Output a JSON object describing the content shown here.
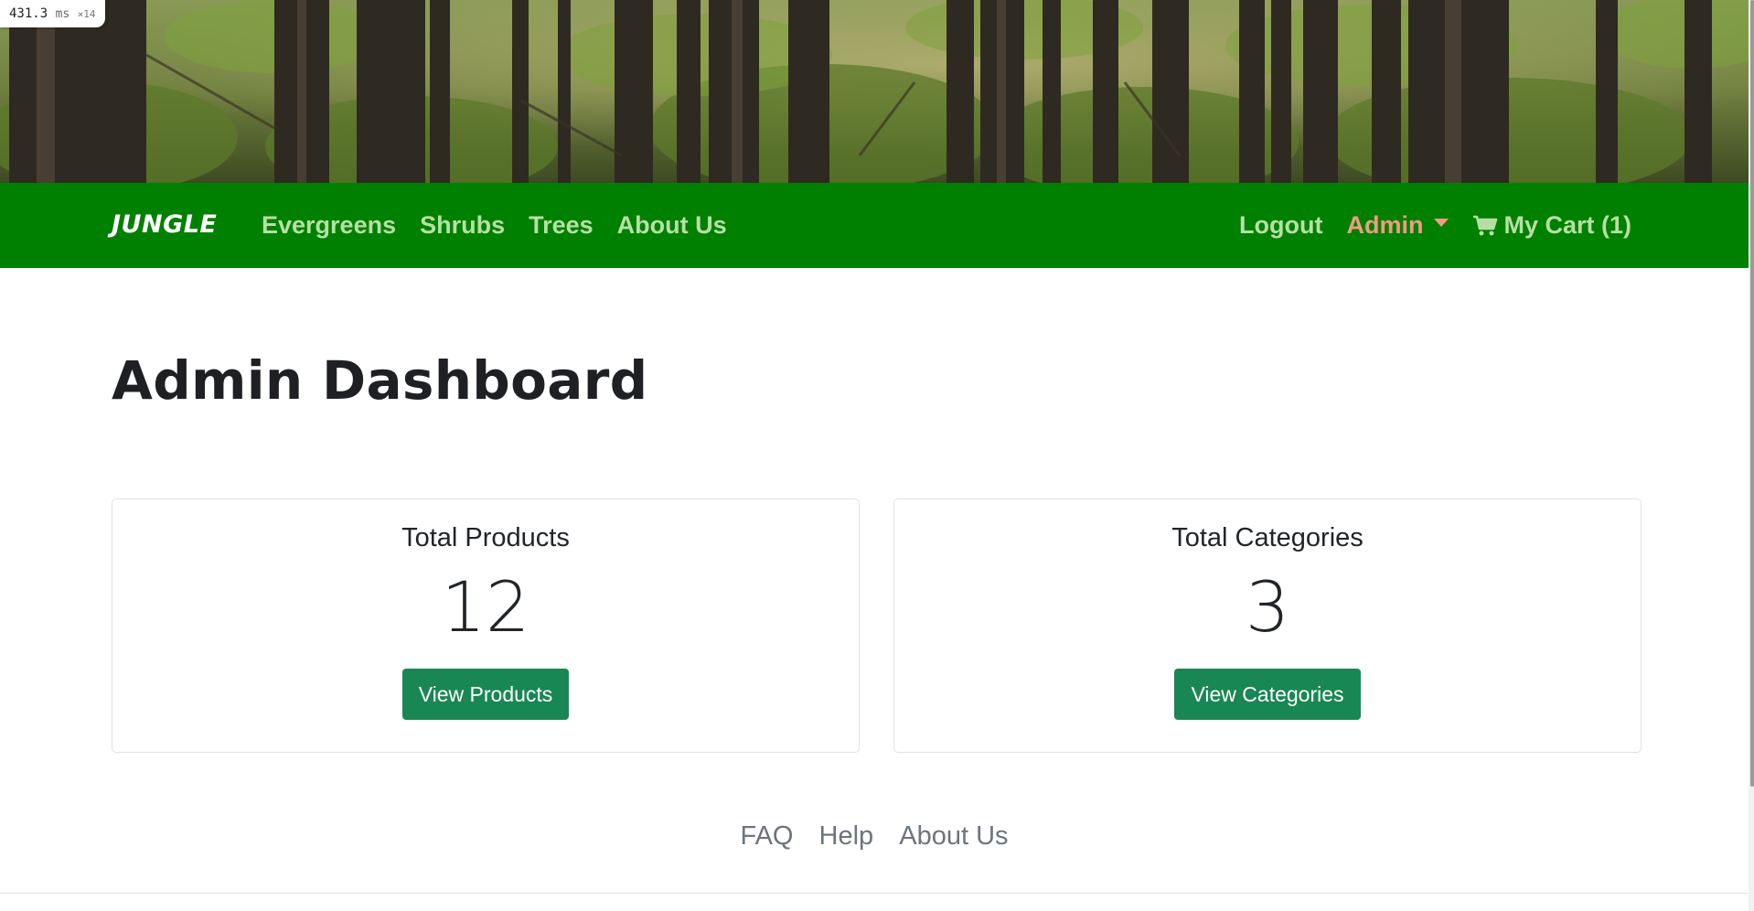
{
  "perf": {
    "value": "431.3",
    "unit": "ms",
    "multiplier": "×14"
  },
  "nav": {
    "brand": "JUNGLE",
    "links": [
      "Evergreens",
      "Shrubs",
      "Trees",
      "About Us"
    ],
    "logout": "Logout",
    "admin": "Admin",
    "cart": "My Cart (1)",
    "cart_icon": "shopping-cart-icon"
  },
  "main": {
    "title": "Admin Dashboard",
    "cards": [
      {
        "title": "Total Products",
        "count": "12",
        "button": "View Products"
      },
      {
        "title": "Total Categories",
        "count": "3",
        "button": "View Categories"
      }
    ]
  },
  "footer": {
    "links": [
      "FAQ",
      "Help",
      "About Us"
    ]
  },
  "colors": {
    "navbar": "#008000",
    "nav_link": "#b7dfa5",
    "admin_link": "#f29a84",
    "button": "#198754"
  }
}
